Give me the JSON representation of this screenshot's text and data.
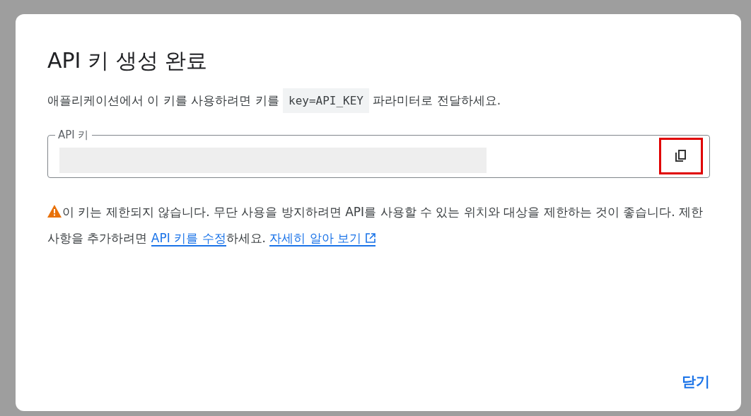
{
  "dialog": {
    "title": "API 키 생성 완료",
    "description": [
      {
        "kind": "text",
        "text": "애플리케이션에서 이 키를 사용하려면 키를 "
      },
      {
        "kind": "code",
        "text": "key=API_KEY"
      },
      {
        "kind": "text",
        "text": " 파라미터로 전달하세요."
      }
    ],
    "key_field": {
      "label": "API 키",
      "value_redacted": true,
      "copy_button": {
        "highlighted": true
      }
    },
    "warning": [
      {
        "kind": "text",
        "text": "이 키는 제한되지 않습니다. 무단 사용을 방지하려면 API를 사용할 수 있는 위치와 대상을 제한하는 것이 좋습니다. 제한사항을 추가하려면 "
      },
      {
        "kind": "link",
        "text": "API 키를 수정"
      },
      {
        "kind": "text",
        "text": "하세요. "
      },
      {
        "kind": "external_link",
        "text": "자세히 알아 보기"
      }
    ],
    "buttons": [
      "닫기"
    ]
  }
}
